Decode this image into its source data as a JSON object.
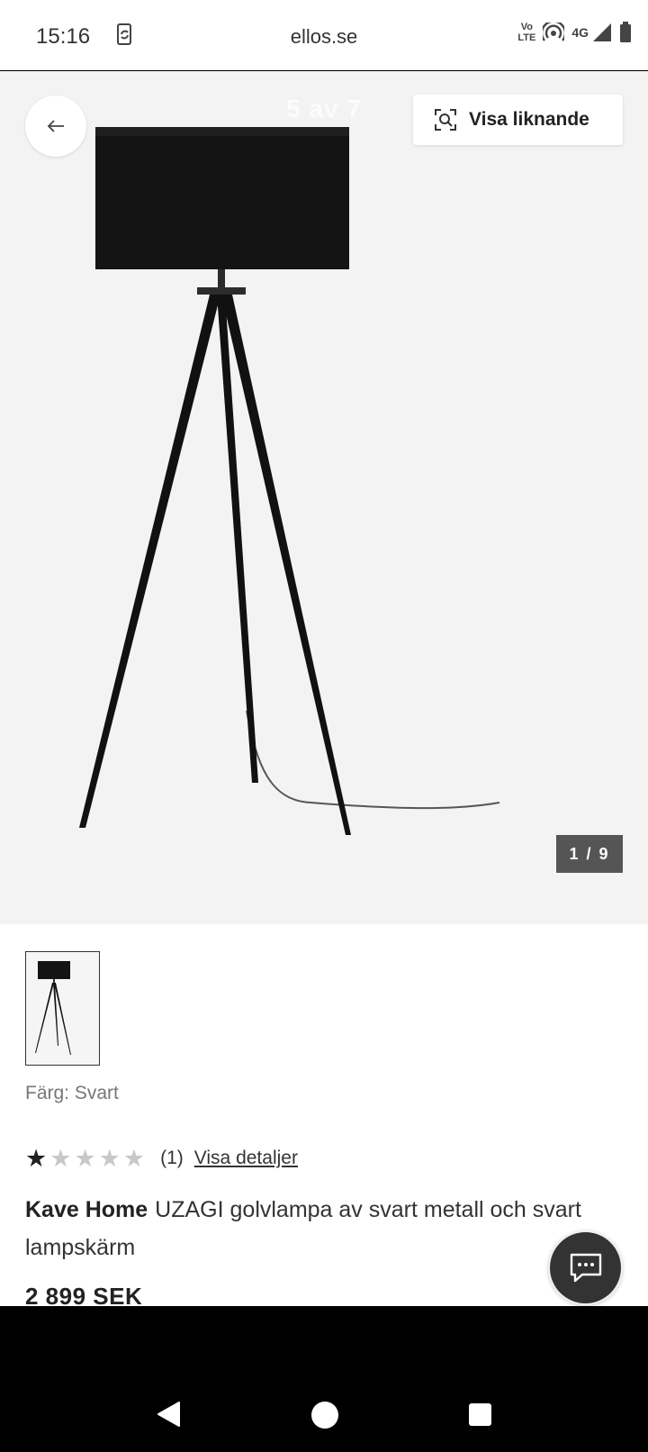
{
  "status_bar": {
    "time": "15:16",
    "url": "ellos.se",
    "volte_top": "Vo",
    "volte_bottom": "LTE",
    "network": "4G",
    "icons": [
      "sync-icon",
      "hotspot-icon",
      "signal-icon",
      "battery-icon"
    ]
  },
  "gallery": {
    "slide_counter": "5 av 7",
    "similar_label": "Visa liknande",
    "image_counter": "1 / 9",
    "background_color": "#f3f3f3"
  },
  "product": {
    "color_prefix": "Färg:",
    "color_value": "Svart",
    "rating": 1,
    "max_rating": 5,
    "review_count": "(1)",
    "details_link": "Visa detaljer",
    "brand": "Kave Home",
    "title": "UZAGI golvlampa av svart metall och svart lampskärm",
    "price": "2 899 SEK"
  },
  "colors": {
    "dark": "#222222",
    "star_off": "#c8c8c8",
    "counter_bg": "#555555"
  }
}
